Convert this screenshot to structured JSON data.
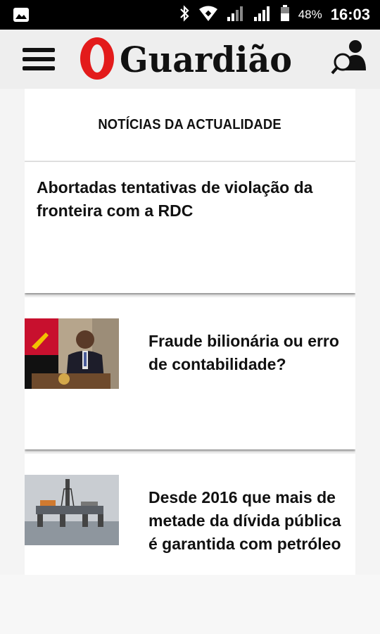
{
  "status_bar": {
    "battery_percent": "48%",
    "time": "16:03",
    "icons": [
      "image-icon",
      "bluetooth-icon",
      "wifi-icon",
      "signal-icon",
      "signal-icon",
      "battery-icon"
    ]
  },
  "app_bar": {
    "logo_text": "O Guardião",
    "menu_icon": "hamburger-menu-icon",
    "account_icon": "account-search-icon"
  },
  "section": {
    "title": "NOTÍCIAS DA ACTUALIDADE"
  },
  "articles": [
    {
      "title": "Abortadas tentativas de violação da fronteira com a RDC",
      "has_image": false
    },
    {
      "title": "Fraude bilionária ou erro de contabilidade?",
      "has_image": true,
      "image": "speaker-at-podium-photo"
    },
    {
      "title": "Desde 2016 que mais de metade da dívida pública é garantida com petróleo",
      "has_image": true,
      "image": "oil-platform-photo"
    }
  ],
  "colors": {
    "status_bar": "#000000",
    "app_bar": "#eeeeee",
    "logo_red": "#e31b1b",
    "background": "#f4f4f4",
    "card": "#ffffff"
  }
}
